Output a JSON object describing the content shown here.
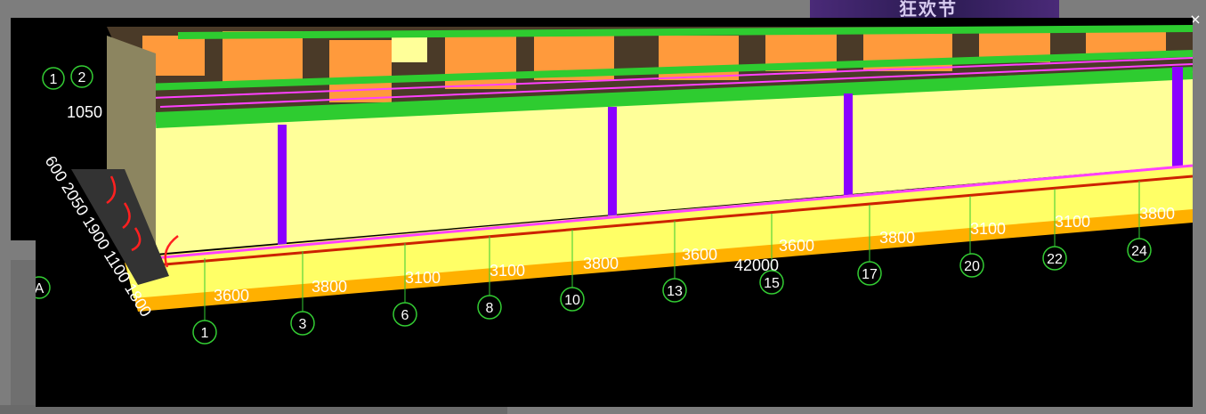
{
  "banner": {
    "text": "狂欢节"
  },
  "close_glyph": "×",
  "bottom_dims": [
    "3600",
    "3800",
    "3100",
    "3100",
    "3800",
    "3600",
    "3600",
    "3800",
    "3100",
    "3100",
    "3800"
  ],
  "total_length": "42000",
  "axis_numbers": [
    "1",
    "3",
    "6",
    "8",
    "10",
    "13",
    "15",
    "17",
    "20",
    "22",
    "24"
  ],
  "left_axis_top": [
    "1",
    "2"
  ],
  "left_dim_top": "1050",
  "left_axis_letter": "A",
  "left_dims_rotated": "600 2050 1900 1100 1800",
  "colors": {
    "floor_slab": "#ffff99",
    "beam": "#2ecc30",
    "column": "#8a00ff",
    "wall": "#ff9a3c",
    "axis": "#33cc33",
    "foundation": "#ffb000",
    "markup": "#ff2020"
  }
}
